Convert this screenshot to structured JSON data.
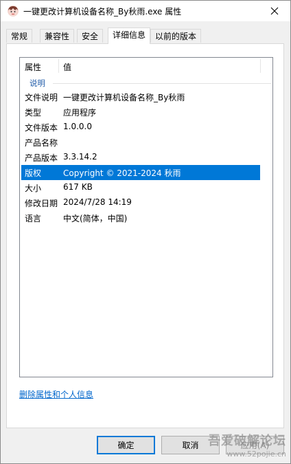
{
  "window": {
    "title": "一键更改计算机设备名称_By秋雨.exe 属性",
    "app_icon": "app-icon",
    "close_icon": "close-icon"
  },
  "tabs": [
    {
      "label": "常规",
      "active": false
    },
    {
      "label": "兼容性",
      "active": false
    },
    {
      "label": "安全",
      "active": false
    },
    {
      "label": "详细信息",
      "active": true
    },
    {
      "label": "以前的版本",
      "active": false
    }
  ],
  "details": {
    "columns": {
      "property": "属性",
      "value": "值"
    },
    "group": "说明",
    "rows": [
      {
        "name": "文件说明",
        "value": "一键更改计算机设备名称_By秋雨",
        "selected": false
      },
      {
        "name": "类型",
        "value": "应用程序",
        "selected": false
      },
      {
        "name": "文件版本",
        "value": "1.0.0.0",
        "selected": false
      },
      {
        "name": "产品名称",
        "value": "",
        "selected": false
      },
      {
        "name": "产品版本",
        "value": "3.3.14.2",
        "selected": false
      },
      {
        "name": "版权",
        "value": "Copyright © 2021-2024 秋雨",
        "selected": true
      },
      {
        "name": "大小",
        "value": "617 KB",
        "selected": false
      },
      {
        "name": "修改日期",
        "value": "2024/7/28 14:19",
        "selected": false
      },
      {
        "name": "语言",
        "value": "中文(简体，中国)",
        "selected": false
      }
    ]
  },
  "remove_link": "删除属性和个人信息",
  "buttons": {
    "ok": "确定",
    "cancel": "取消",
    "apply": "应用(A)"
  },
  "watermark": {
    "line1": "吾爱破解论坛",
    "line2": "www.52pojie.cn"
  },
  "colors": {
    "accent": "#0078d7",
    "link": "#0066cc",
    "group": "#1e5aa8"
  }
}
